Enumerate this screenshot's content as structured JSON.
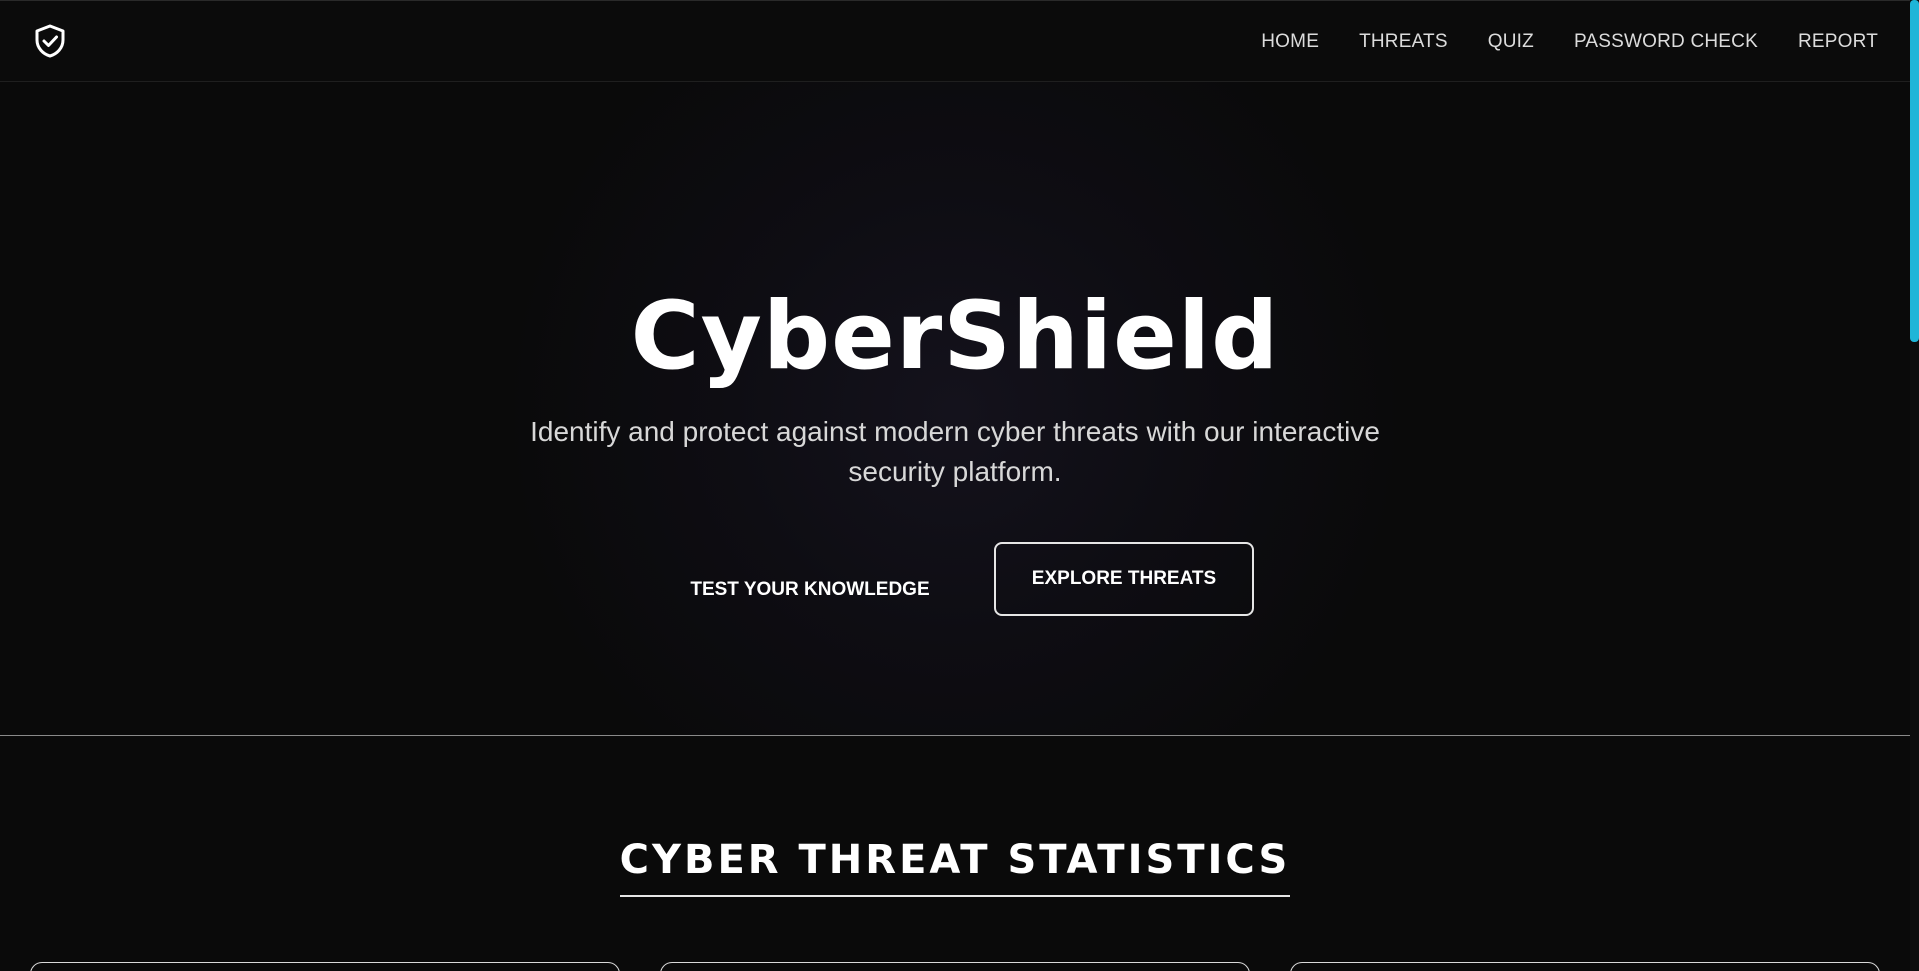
{
  "nav": {
    "logo_icon": "shield-check-icon",
    "links": [
      "HOME",
      "THREATS",
      "QUIZ",
      "PASSWORD CHECK",
      "REPORT"
    ]
  },
  "hero": {
    "title": "CyberShield",
    "subtitle": "Identify and protect against modern cyber threats with our interactive security platform.",
    "primary_button": "TEST YOUR KNOWLEDGE",
    "secondary_button": "EXPLORE THREATS"
  },
  "stats": {
    "heading": "CYBER THREAT STATISTICS"
  },
  "colors": {
    "background": "#0a0a0a",
    "text": "#ffffff",
    "scroll_thumb": "#1fb5d8"
  }
}
